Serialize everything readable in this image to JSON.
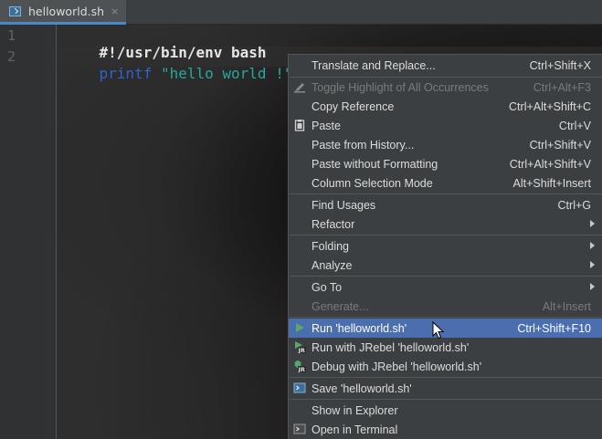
{
  "tab": {
    "icon": "shell-script-icon",
    "label": "helloworld.sh",
    "close": "×"
  },
  "editor": {
    "line_numbers": [
      "1",
      "2"
    ],
    "line1": "#!/usr/bin/env bash",
    "line2_keyword": "printf",
    "line2_space": " ",
    "line2_string": "\"hello world !\""
  },
  "menu": {
    "items": [
      {
        "label": "Translate and Replace...",
        "shortcut": "Ctrl+Shift+X"
      },
      {
        "label": "Toggle Highlight of All Occurrences",
        "shortcut": "Ctrl+Alt+F3",
        "disabled": true,
        "icon": "highlighter-icon"
      },
      {
        "label": "Copy Reference",
        "shortcut": "Ctrl+Alt+Shift+C"
      },
      {
        "label": "Paste",
        "shortcut": "Ctrl+V",
        "icon": "clipboard-icon"
      },
      {
        "label": "Paste from History...",
        "shortcut": "Ctrl+Shift+V"
      },
      {
        "label": "Paste without Formatting",
        "shortcut": "Ctrl+Alt+Shift+V"
      },
      {
        "label": "Column Selection Mode",
        "shortcut": "Alt+Shift+Insert"
      },
      {
        "label": "Find Usages",
        "shortcut": "Ctrl+G"
      },
      {
        "label": "Refactor",
        "submenu": true
      },
      {
        "label": "Folding",
        "submenu": true
      },
      {
        "label": "Analyze",
        "submenu": true
      },
      {
        "label": "Go To",
        "submenu": true
      },
      {
        "label": "Generate...",
        "shortcut": "Alt+Insert",
        "disabled": true
      },
      {
        "label": "Run 'helloworld.sh'",
        "shortcut": "Ctrl+Shift+F10",
        "selected": true,
        "icon": "run-icon"
      },
      {
        "label": "Run with JRebel 'helloworld.sh'",
        "icon": "jrebel-run-icon"
      },
      {
        "label": "Debug with JRebel 'helloworld.sh'",
        "icon": "jrebel-debug-icon"
      },
      {
        "label": "Save 'helloworld.sh'",
        "icon": "shell-script-icon"
      },
      {
        "label": "Show in Explorer"
      },
      {
        "label": "Open in Terminal",
        "icon": "terminal-icon"
      }
    ]
  },
  "colors": {
    "keyword": "#2f63c9",
    "string": "#27a89a",
    "selection": "#4b6eaf",
    "menu_bg": "#3c3f41",
    "run_green": "#59a869"
  }
}
